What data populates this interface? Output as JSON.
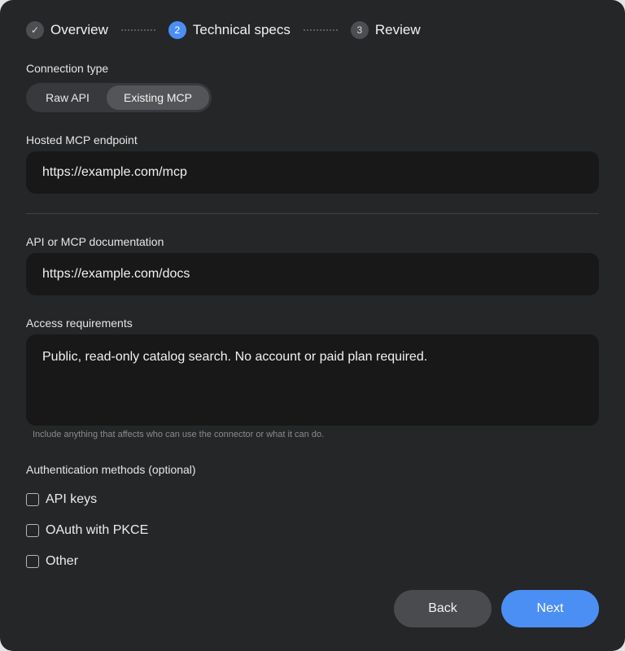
{
  "stepper": {
    "steps": [
      {
        "label": "Overview",
        "marker": "✓",
        "state": "done"
      },
      {
        "label": "Technical specs",
        "marker": "2",
        "state": "active"
      },
      {
        "label": "Review",
        "marker": "3",
        "state": "pending"
      }
    ]
  },
  "connection": {
    "label": "Connection type",
    "options": [
      "Raw API",
      "Existing MCP"
    ],
    "selected": "Existing MCP"
  },
  "endpoint": {
    "label": "Hosted MCP endpoint",
    "value": "https://example.com/mcp"
  },
  "docs": {
    "label": "API or MCP documentation",
    "value": "https://example.com/docs"
  },
  "access": {
    "label": "Access requirements",
    "value": "Public, read-only catalog search. No account or paid plan required.",
    "hint": "Include anything that affects who can use the connector or what it can do."
  },
  "auth": {
    "label": "Authentication methods (optional)",
    "options": [
      {
        "label": "API keys",
        "checked": false
      },
      {
        "label": "OAuth with PKCE",
        "checked": false
      },
      {
        "label": "Other",
        "checked": false
      }
    ]
  },
  "actions": {
    "back": "Back",
    "next": "Next"
  },
  "colors": {
    "accent": "#4b8ff5",
    "background": "#252628",
    "field": "#181818"
  }
}
